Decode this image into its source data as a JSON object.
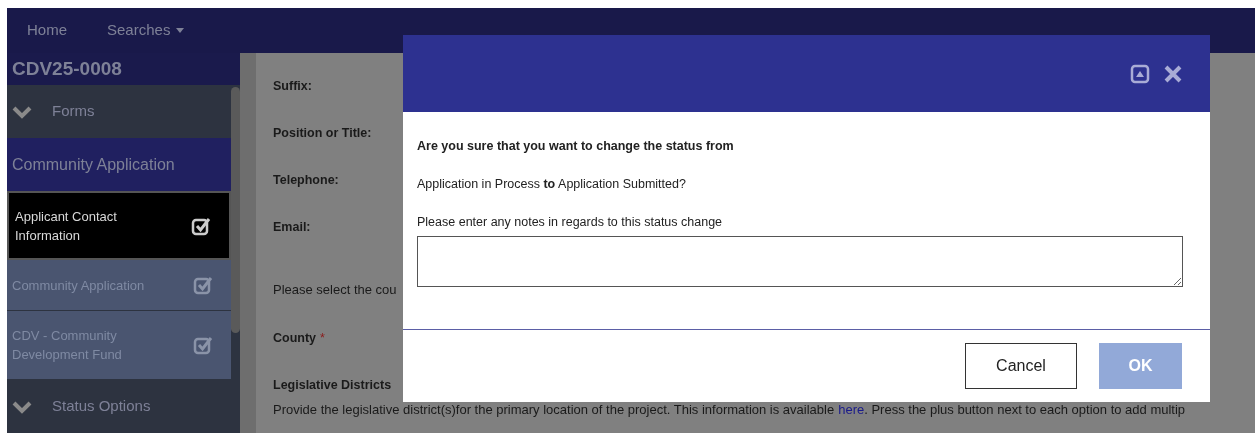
{
  "nav": [
    {
      "label": "Home",
      "dropdown": false
    },
    {
      "label": "Searches",
      "dropdown": true
    }
  ],
  "sidebar": {
    "title": "CDV25-0008",
    "items": [
      {
        "kind": "group",
        "label": "Forms",
        "expanded": true
      },
      {
        "kind": "header",
        "label": "Community Application"
      },
      {
        "kind": "form",
        "label": "Applicant Contact Information",
        "selected": true,
        "checked": true
      },
      {
        "kind": "form",
        "label": "Community Application",
        "selected": false,
        "checked": true
      },
      {
        "kind": "form",
        "label": "CDV - Community Development Fund",
        "selected": false,
        "checked": true
      },
      {
        "kind": "group",
        "label": "Status Options",
        "expanded": true
      }
    ]
  },
  "form": {
    "items": [
      {
        "kind": "label",
        "label": "Suffix:"
      },
      {
        "kind": "label",
        "label": "Position or Title:"
      },
      {
        "kind": "label",
        "label": "Telephone:"
      },
      {
        "kind": "label",
        "label": "Email:"
      },
      {
        "kind": "note",
        "label": "Please select the cou"
      },
      {
        "kind": "label",
        "label": "County",
        "marker": "*"
      },
      {
        "kind": "heading",
        "label": "Legislative Districts"
      }
    ],
    "description": {
      "before": "Provide the legislative district(s)for the primary location of the project. This information is available",
      "link": "here",
      "after": ". Press the plus button next to each option to add multip"
    }
  },
  "modal": {
    "question": "Are you sure that you want to change the status from",
    "status_line": "Application in Process **to** Application Submitted?",
    "notes_label": "Please enter any notes in regards to this status change",
    "buttons": [
      {
        "kind": "secondary",
        "label": "Cancel",
        "disabled": false
      },
      {
        "kind": "primary",
        "label": "OK",
        "disabled": true
      }
    ]
  }
}
